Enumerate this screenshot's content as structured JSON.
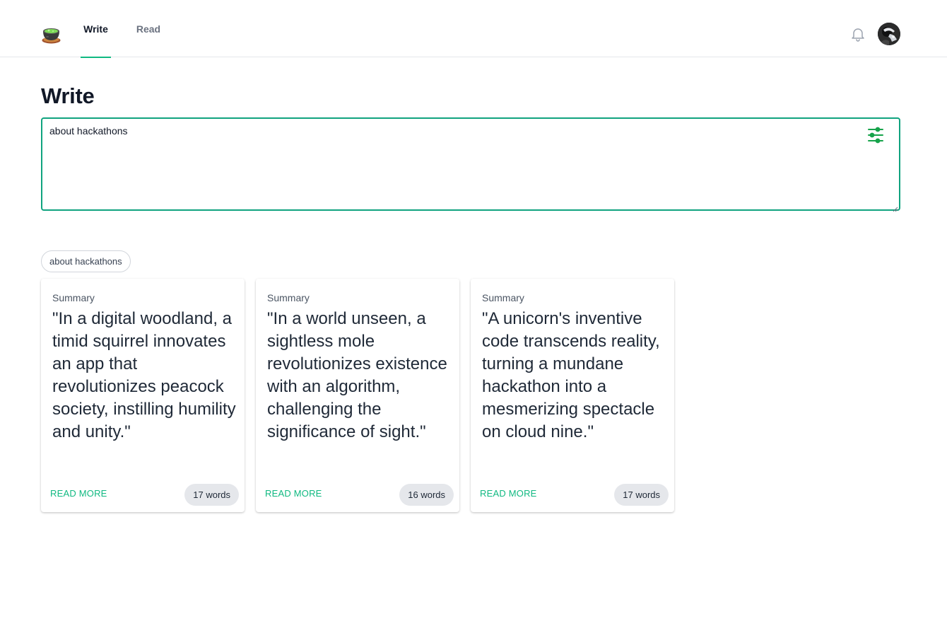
{
  "nav": {
    "tabs": [
      {
        "label": "Write",
        "active": true
      },
      {
        "label": "Read",
        "active": false
      }
    ]
  },
  "page": {
    "title": "Write"
  },
  "prompt": {
    "value": "about hackathons"
  },
  "chip": {
    "label": "about hackathons"
  },
  "cards": [
    {
      "label": "Summary",
      "text": "\"In a digital woodland, a timid squirrel innovates an app that revolutionizes peacock society, instilling humility and unity.\"",
      "read_more": "READ MORE",
      "word_count": "17 words"
    },
    {
      "label": "Summary",
      "text": "\"In a world unseen, a sightless mole revolutionizes existence with an algorithm, challenging the significance of sight.\"",
      "read_more": "READ MORE",
      "word_count": "16 words"
    },
    {
      "label": "Summary",
      "text": "\"A unicorn's inventive code transcends reality, turning a mundane hackathon into a mesmerizing spectacle on cloud nine.\"",
      "read_more": "READ MORE",
      "word_count": "17 words"
    }
  ],
  "icons": {
    "logo": "cauldron-icon",
    "notifications": "bell-icon",
    "settings": "sliders-icon"
  },
  "colors": {
    "accent": "#10b981",
    "border_focus": "#10a37f",
    "badge_bg": "#e5e7eb"
  }
}
